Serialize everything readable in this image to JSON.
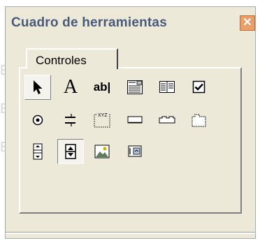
{
  "window": {
    "title": "Cuadro de herramientas",
    "close_glyph": "✕"
  },
  "tabs": [
    {
      "label": "Controles",
      "selected": true
    }
  ],
  "tools": [
    {
      "name": "select-pointer-icon",
      "row": 1,
      "col": 1,
      "state": "pressed"
    },
    {
      "name": "label-icon",
      "row": 1,
      "col": 2,
      "glyph": "A"
    },
    {
      "name": "textbox-icon",
      "row": 1,
      "col": 3,
      "glyph": "ab|"
    },
    {
      "name": "combobox-icon",
      "row": 1,
      "col": 4
    },
    {
      "name": "listbox-icon",
      "row": 1,
      "col": 5
    },
    {
      "name": "checkbox-icon",
      "row": 1,
      "col": 6
    },
    {
      "name": "option-button-icon",
      "row": 2,
      "col": 1
    },
    {
      "name": "toggle-button-icon",
      "row": 2,
      "col": 2
    },
    {
      "name": "frame-icon",
      "row": 2,
      "col": 3,
      "glyph": "XYZ"
    },
    {
      "name": "command-button-icon",
      "row": 2,
      "col": 4
    },
    {
      "name": "tabstrip-icon",
      "row": 2,
      "col": 5
    },
    {
      "name": "multipage-icon",
      "row": 2,
      "col": 6
    },
    {
      "name": "scrollbar-icon",
      "row": 3,
      "col": 1
    },
    {
      "name": "spinbutton-icon",
      "row": 3,
      "col": 2,
      "state": "sunken"
    },
    {
      "name": "image-icon",
      "row": 3,
      "col": 3
    },
    {
      "name": "refedit-icon",
      "row": 3,
      "col": 4
    }
  ],
  "background_ghost_chars": [
    "E",
    "E",
    "E"
  ]
}
